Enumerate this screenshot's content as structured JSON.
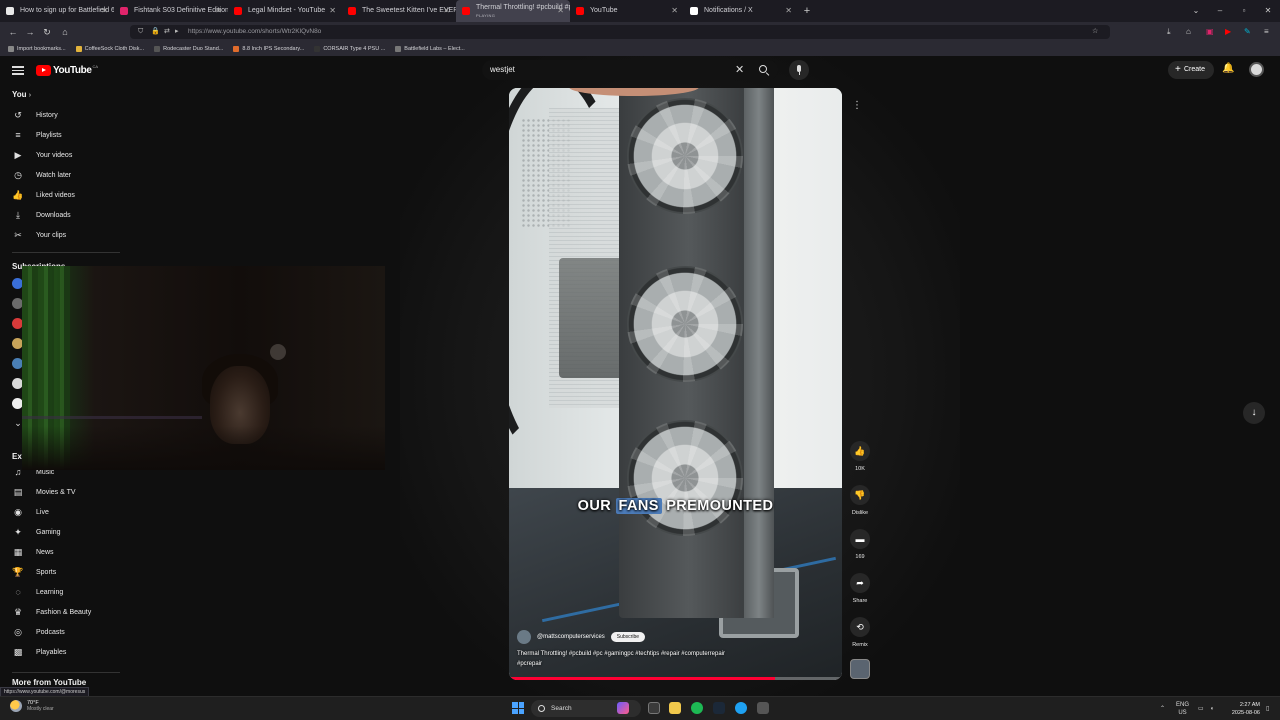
{
  "browser": {
    "tabs": [
      {
        "title": "How to sign up for Battlefield 6",
        "favicon_color": "#e8e8e8",
        "active": false
      },
      {
        "title": "Fishtank S03 Definitive Edition |",
        "favicon_color": "#e0246b",
        "active": false
      },
      {
        "title": "Legal Mindset - YouTube",
        "favicon_color": "#ff0000",
        "active": false
      },
      {
        "title": "The Sweetest Kitten I've EVER G",
        "favicon_color": "#ff0000",
        "active": false
      },
      {
        "title": "Thermal Throttling! #pcbuild #p",
        "subtitle": "PLAYING",
        "favicon_color": "#ff0000",
        "active": true
      },
      {
        "title": "YouTube",
        "favicon_color": "#ff0000",
        "active": false
      },
      {
        "title": "Notifications / X",
        "favicon_color": "#ffffff",
        "active": false
      }
    ],
    "url": "https://www.youtube.com/shorts/Wtr2KlQvN8o",
    "bookmarks": [
      {
        "label": "Import bookmarks...",
        "color": "#888"
      },
      {
        "label": "CoffeeSock Cloth Disk...",
        "color": "#e2b33c"
      },
      {
        "label": "Rodecaster Duo Stand...",
        "color": "#555"
      },
      {
        "label": "8.8 Inch IPS Secondary...",
        "color": "#e06c2c"
      },
      {
        "label": "CORSAIR Type 4 PSU ...",
        "color": "#333"
      },
      {
        "label": "Battlefield Labs – Elect...",
        "color": "#777"
      }
    ]
  },
  "youtube": {
    "logo_text": "YouTube",
    "region": "CA",
    "search_query": "westjet",
    "create_label": "Create",
    "sidebar": {
      "you_title": "You",
      "you_items": [
        {
          "label": "History",
          "icon": "↺"
        },
        {
          "label": "Playlists",
          "icon": "≡"
        },
        {
          "label": "Your videos",
          "icon": "▶"
        },
        {
          "label": "Watch later",
          "icon": "◷"
        },
        {
          "label": "Liked videos",
          "icon": "👍"
        },
        {
          "label": "Downloads",
          "icon": "⤓"
        },
        {
          "label": "Your clips",
          "icon": "✂"
        }
      ],
      "subscriptions_title": "Subscriptions",
      "subscription_dot_colors": [
        "#3a6fd8",
        "#6b6b6b",
        "#d93a3a",
        "#c8a45a",
        "#4a7fb5",
        "#d9d9d9",
        "#eeeeee"
      ],
      "explore_title": "Explore",
      "explore_items": [
        {
          "label": "Music",
          "icon": "♫"
        },
        {
          "label": "Movies & TV",
          "icon": "▤"
        },
        {
          "label": "Live",
          "icon": "◉"
        },
        {
          "label": "Gaming",
          "icon": "✦"
        },
        {
          "label": "News",
          "icon": "▦"
        },
        {
          "label": "Sports",
          "icon": "🏆"
        },
        {
          "label": "Learning",
          "icon": "◌"
        },
        {
          "label": "Fashion & Beauty",
          "icon": "♛"
        },
        {
          "label": "Podcasts",
          "icon": "◎"
        },
        {
          "label": "Playables",
          "icon": "▩"
        }
      ],
      "more_title": "More from YouTube"
    },
    "short": {
      "caption_pre": "OUR",
      "caption_highlight": "FANS",
      "caption_post": "PREMOUNTED",
      "channel": "@mattscomputerservices",
      "subscribe_label": "Subscribe",
      "description": "Thermal Throttling! #pcbuild #pc #gamingpc #techtips #repair #computerrepair #pcrepair",
      "progress": 0.8
    },
    "actions": {
      "like_count": "10K",
      "dislike_label": "Dislike",
      "comment_count": "169",
      "share_label": "Share",
      "remix_label": "Remix"
    }
  },
  "status_link": "https://www.youtube.com/@moresus",
  "taskbar": {
    "temp": "70°F",
    "weather": "Mostly clear",
    "search_label": "Search",
    "lang_top": "ENG",
    "lang_bottom": "US",
    "time": "2:27 AM",
    "date": "2025-08-06"
  }
}
